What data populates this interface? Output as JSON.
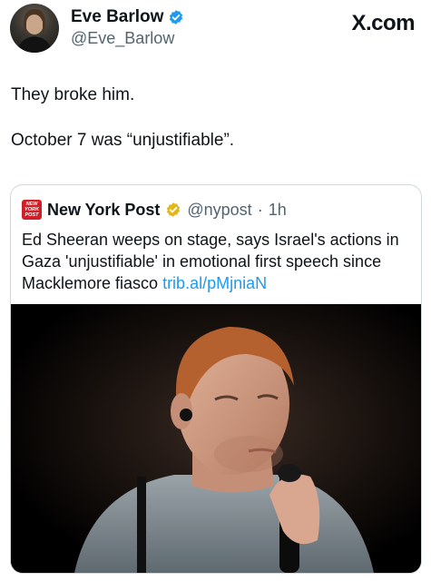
{
  "author": {
    "name": "Eve Barlow",
    "handle": "@Eve_Barlow",
    "verified": true,
    "avatar": "avatar"
  },
  "watermark": "X.com",
  "tweet": {
    "lines": [
      "They broke him.",
      "October 7 was “unjustifiable”."
    ]
  },
  "quote": {
    "logo_text": [
      "NEW",
      "YORK",
      "POST"
    ],
    "name": "New York Post",
    "verified_color": "#e2b719",
    "handle": "@nypost",
    "separator": "·",
    "time": "1h",
    "text": "Ed Sheeran weeps on stage, says Israel's actions in Gaza 'unjustifiable' in emotional first speech since Macklemore fiasco ",
    "link": "trib.al/pMjniaN",
    "media": "photo-of-singer-with-microphone"
  },
  "colors": {
    "verified_blue": "#1d9bf0",
    "link": "#1d9bf0",
    "nyp_red": "#d01f26"
  }
}
